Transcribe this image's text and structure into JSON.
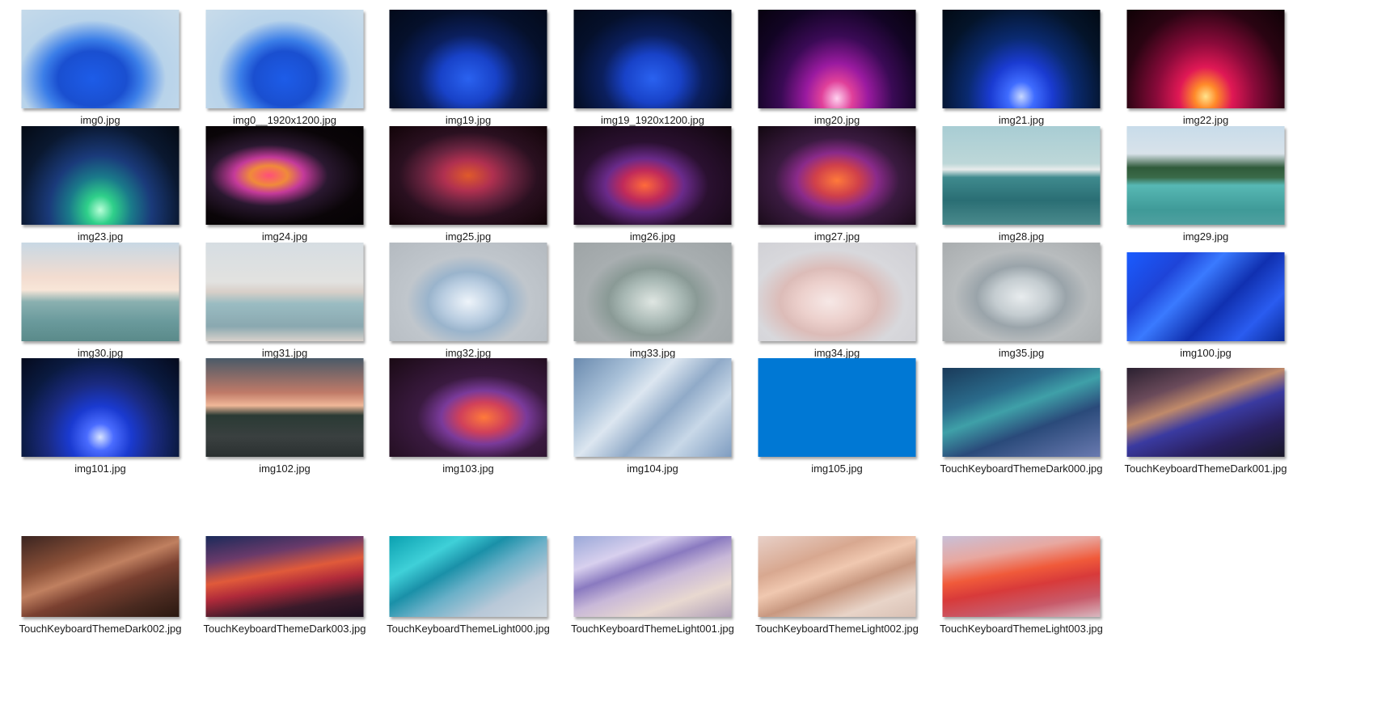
{
  "files": [
    {
      "name": "img0.jpg",
      "bg": "radial-gradient(ellipse at 45% 70%, #1d5ce8 0%, #1a4fd0 28%, #3b7ee8 40%, #b8d3ea 60%, #c9dcea 100%)"
    },
    {
      "name": "img0__1920x1200.jpg",
      "bg": "radial-gradient(ellipse at 50% 70%, #1d5ce8 0%, #1a4fd0 28%, #3b7ee8 40%, #b8d3ea 60%, #c9dcea 100%)"
    },
    {
      "name": "img19.jpg",
      "bg": "radial-gradient(ellipse at 50% 70%, #2a62f0 0%, #1842c8 25%, #0b1f5e 45%, #05102b 70%, #030a1a 100%)"
    },
    {
      "name": "img19_1920x1200.jpg",
      "bg": "radial-gradient(ellipse at 50% 70%, #2a62f0 0%, #1842c8 25%, #0b1f5e 45%, #05102b 70%, #030a1a 100%)"
    },
    {
      "name": "img20.jpg",
      "bg": "radial-gradient(ellipse at 50% 90%, #ffd2f0 0%, #e0409a 14%, #9a1aa0 28%, #3a0a55 50%, #120424 75%, #08020f 100%)"
    },
    {
      "name": "img21.jpg",
      "bg": "radial-gradient(ellipse at 50% 88%, #c8d8ff 0%, #3f6cff 12%, #1a3bd1 28%, #0a2a70 48%, #04142a 75%, #020a14 100%)"
    },
    {
      "name": "img22.jpg",
      "bg": "radial-gradient(ellipse at 50% 88%, #ffe48c 0%, #ff8a2a 10%, #e01855 24%, #8a0a3a 44%, #2a0412 72%, #0f0206 100%)"
    },
    {
      "name": "img23.jpg",
      "bg": "radial-gradient(ellipse at 50% 85%, #b8ffd8 0%, #2fd08a 12%, #1a7a8a 28%, #1a3a7a 46%, #0a1830 72%, #040a14 100%)"
    },
    {
      "name": "img24.jpg",
      "bg": "radial-gradient(ellipse at 40% 50%, #ff4f7a 0%, #f08a3a 14%, #c43a9a 26%, #2a1830 44%, #0a0508 70%, #050204 100%)"
    },
    {
      "name": "img25.jpg",
      "bg": "radial-gradient(ellipse at 50% 50%, #e05a2a 0%, #b03050 22%, #6a2440 40%, #2a1020 62%, #120408 100%)"
    },
    {
      "name": "img26.jpg",
      "bg": "radial-gradient(ellipse at 45% 60%, #ff6a3a 0%, #c02a5a 18%, #6a2a8a 32%, #2a1030 52%, #0f060c 100%)"
    },
    {
      "name": "img27.jpg",
      "bg": "radial-gradient(ellipse at 50% 55%, #ff7a3a 0%, #d0404a 20%, #8a2a8a 36%, #3a1a40 56%, #120810 100%)"
    },
    {
      "name": "img28.jpg",
      "bg": "linear-gradient(180deg, #a8cdd4 0%, #bdd7d8 38%, #e8ecec 44%, #3f8a8e 52%, #2a6e74 75%, #4a8a8c 100%)"
    },
    {
      "name": "img29.jpg",
      "bg": "linear-gradient(180deg, #c8dcea 0%, #d8e2ea 28%, #2f5a3a 42%, #3a6a48 52%, #57b8b4 60%, #3f9a98 85%, #4fa0a0 100%)"
    },
    {
      "name": "img30.jpg",
      "bg": "linear-gradient(180deg, #c8d8e4 0%, #f2dcd0 35%, #f8e6d8 48%, #8ab0b0 60%, #6a9a9c 80%, #5a8a8a 100%)"
    },
    {
      "name": "img31.jpg",
      "bg": "linear-gradient(180deg, #d6dde2 0%, #e2e2e0 40%, #d8cfc8 50%, #9abcc2 62%, #8aa8b0 85%, #d8d2cc 100%)"
    },
    {
      "name": "img32.jpg",
      "bg": "radial-gradient(ellipse at 50% 60%, #eef4fa 0%, #b8cce0 24%, #9ab4cc 36%, #c0c6cc 55%, #b4bac0 100%)"
    },
    {
      "name": "img33.jpg",
      "bg": "radial-gradient(ellipse at 50% 60%, #dfe6e2 0%, #a8b8b4 26%, #8a9a96 40%, #a8aeb0 60%, #9ea4a6 100%)"
    },
    {
      "name": "img34.jpg",
      "bg": "radial-gradient(ellipse at 45% 60%, #f6e8e6 0%, #ecd0cc 24%, #dcbcb8 40%, #d8d8dc 62%, #cfcfd4 100%)"
    },
    {
      "name": "img35.jpg",
      "bg": "radial-gradient(ellipse at 50% 55%, #e8ecee 0%, #c4ccd0 24%, #9aa4aa 40%, #b8bcbe 60%, #a8acae 100%)"
    },
    {
      "name": "img100.jpg",
      "bg": "linear-gradient(135deg, #1a5cff 0%, #1e44d8 25%, #3a7aff 40%, #1030b0 60%, #2a5cf0 80%, #0a2a9a 100%)"
    },
    {
      "name": "img101.jpg",
      "bg": "radial-gradient(ellipse at 50% 80%, #d8e4ff 0%, #4a6cff 12%, #1a3ad0 28%, #1a2a80 48%, #0a1a40 72%, #050a1c 100%)"
    },
    {
      "name": "img102.jpg",
      "bg": "linear-gradient(180deg, #4a5a68 0%, #c07a68 35%, #f0b898 48%, #2a3a34 58%, #3a4040 80%, #2a3030 100%)"
    },
    {
      "name": "img103.jpg",
      "bg": "radial-gradient(ellipse at 60% 60%, #ff7a3a 0%, #d0405a 18%, #7a3a9a 32%, #3a1a40 50%, #1a0a14 100%)"
    },
    {
      "name": "img104.jpg",
      "bg": "linear-gradient(135deg, #6a8aae 0%, #a8c0d8 25%, #dce6f0 40%, #90aac8 58%, #c8d8e8 75%, #7e9cc0 100%)"
    },
    {
      "name": "img105.jpg",
      "bg": "#0078d4"
    },
    {
      "name": "TouchKeyboardThemeDark000.jpg",
      "bg": "linear-gradient(160deg, #1a3a5a 0%, #2a6a8a 30%, #3fa0a8 45%, #2a4a7a 65%, #6a7ab0 100%)"
    },
    {
      "name": "TouchKeyboardThemeDark001.jpg",
      "bg": "linear-gradient(160deg, #2a2030 0%, #6a4a5a 25%, #c08a6a 40%, #3a3aa0 55%, #2a2060 75%, #1a1828 100%)"
    },
    {
      "name": "TouchKeyboardThemeDark002.jpg",
      "bg": "linear-gradient(160deg, #3a2420 0%, #8a5038 30%, #c08060 45%, #7a4030 60%, #4a2a20 80%, #2a1810 100%)"
    },
    {
      "name": "TouchKeyboardThemeDark003.jpg",
      "bg": "linear-gradient(170deg, #1a2a5a 0%, #6a3a6a 25%, #e05a3a 45%, #b02a3a 60%, #3a1a2a 80%, #1a1020 100%)"
    },
    {
      "name": "TouchKeyboardThemeLight000.jpg",
      "bg": "linear-gradient(150deg, #0aa0b0 0%, #3fd0d8 25%, #1a90a8 40%, #6ab0c8 55%, #b8c8d8 75%, #d0d8e0 100%)"
    },
    {
      "name": "TouchKeyboardThemeLight001.jpg",
      "bg": "linear-gradient(160deg, #9aa8d8 0%, #d8d0ee 25%, #8a7ac0 40%, #c8b8d8 55%, #e8d8d0 75%, #b0a0b8 100%)"
    },
    {
      "name": "TouchKeyboardThemeLight002.jpg",
      "bg": "linear-gradient(160deg, #e8d0c8 0%, #d8a890 30%, #f0c8b0 45%, #c89880 60%, #e8d4c8 80%, #d8c0b4 100%)"
    },
    {
      "name": "TouchKeyboardThemeLight003.jpg",
      "bg": "linear-gradient(170deg, #c8c0d8 0%, #e8a8a0 25%, #f05a3a 45%, #d83a3a 60%, #c85a6a 80%, #d8b8c0 100%)"
    }
  ]
}
